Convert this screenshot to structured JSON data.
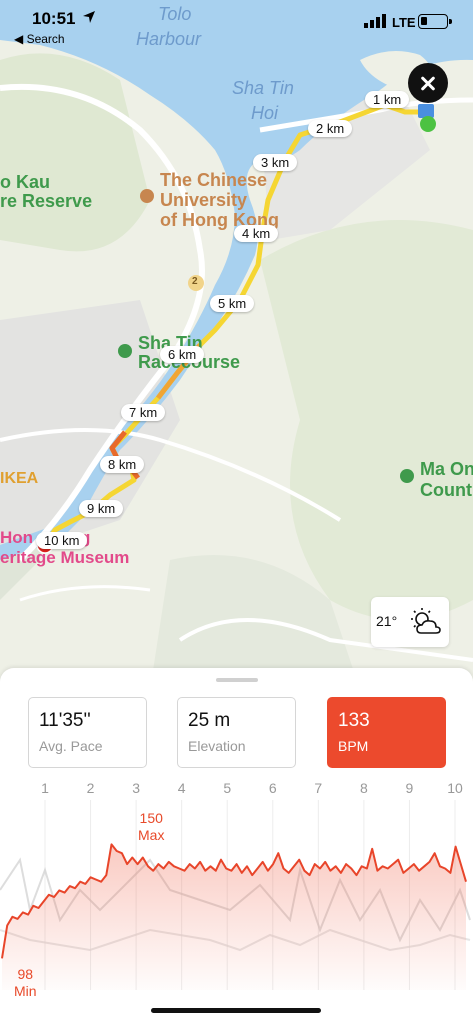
{
  "status_bar": {
    "time": "10:51",
    "back_label": "Search",
    "network": "LTE"
  },
  "map": {
    "labels": {
      "tolo": "Tolo",
      "harbour": "Harbour",
      "shatin": "Sha Tin",
      "hoi": "Hoi",
      "kau": "o Kau",
      "reserve": "re Reserve",
      "cuhk1": "The Chinese",
      "cuhk2": "University",
      "cuhk3": "of Hong Kong",
      "race1": "Sha Tin",
      "race2": "Racecourse",
      "ikea": "IKEA",
      "museum1": "Hon",
      "museum1b": "g",
      "museum2": "eritage Museum",
      "maon1": "Ma On",
      "maon2": "Count",
      "route_badge": "2"
    },
    "km_markers": [
      "1 km",
      "2 km",
      "3 km",
      "4 km",
      "5 km",
      "6 km",
      "7 km",
      "8 km",
      "9 km",
      "10 km"
    ],
    "colors": {
      "start": "#4cc242",
      "end": "#e0241c",
      "route": "#f5d633",
      "route_hot": "#e86a2a"
    }
  },
  "weather": {
    "temperature": "21°",
    "icon": "partly-cloudy-icon"
  },
  "stats": {
    "pace": {
      "value": "11'35''",
      "label": "Avg. Pace"
    },
    "elevation": {
      "value": "25 m",
      "label": "Elevation"
    },
    "heart_rate": {
      "value": "133",
      "label": "BPM"
    }
  },
  "chart_data": {
    "type": "line",
    "x_ticks": [
      "1",
      "2",
      "3",
      "4",
      "5",
      "6",
      "7",
      "8",
      "9",
      "10"
    ],
    "max": {
      "value": "150",
      "label": "Max"
    },
    "min": {
      "value": "98",
      "label": "Min"
    },
    "series": [
      {
        "color": "#e8452a",
        "values": [
          98,
          113,
          117,
          116,
          119,
          118,
          122,
          121,
          124,
          127,
          126,
          129,
          128,
          131,
          130,
          133,
          132,
          135,
          134,
          133,
          136,
          150,
          147,
          146,
          141,
          144,
          141,
          144,
          140,
          138,
          141,
          139,
          142,
          140,
          139,
          138,
          141,
          139,
          142,
          138,
          140,
          138,
          143,
          139,
          138,
          141,
          137,
          140,
          136,
          139,
          142,
          138,
          141,
          146,
          139,
          137,
          140,
          143,
          138,
          136,
          141,
          139,
          142,
          138,
          140,
          137,
          141,
          139,
          136,
          140,
          139,
          148,
          138,
          140,
          139,
          141,
          143,
          137,
          139,
          141,
          138,
          140,
          142,
          146,
          140,
          139,
          137,
          149,
          141,
          133
        ]
      }
    ]
  }
}
